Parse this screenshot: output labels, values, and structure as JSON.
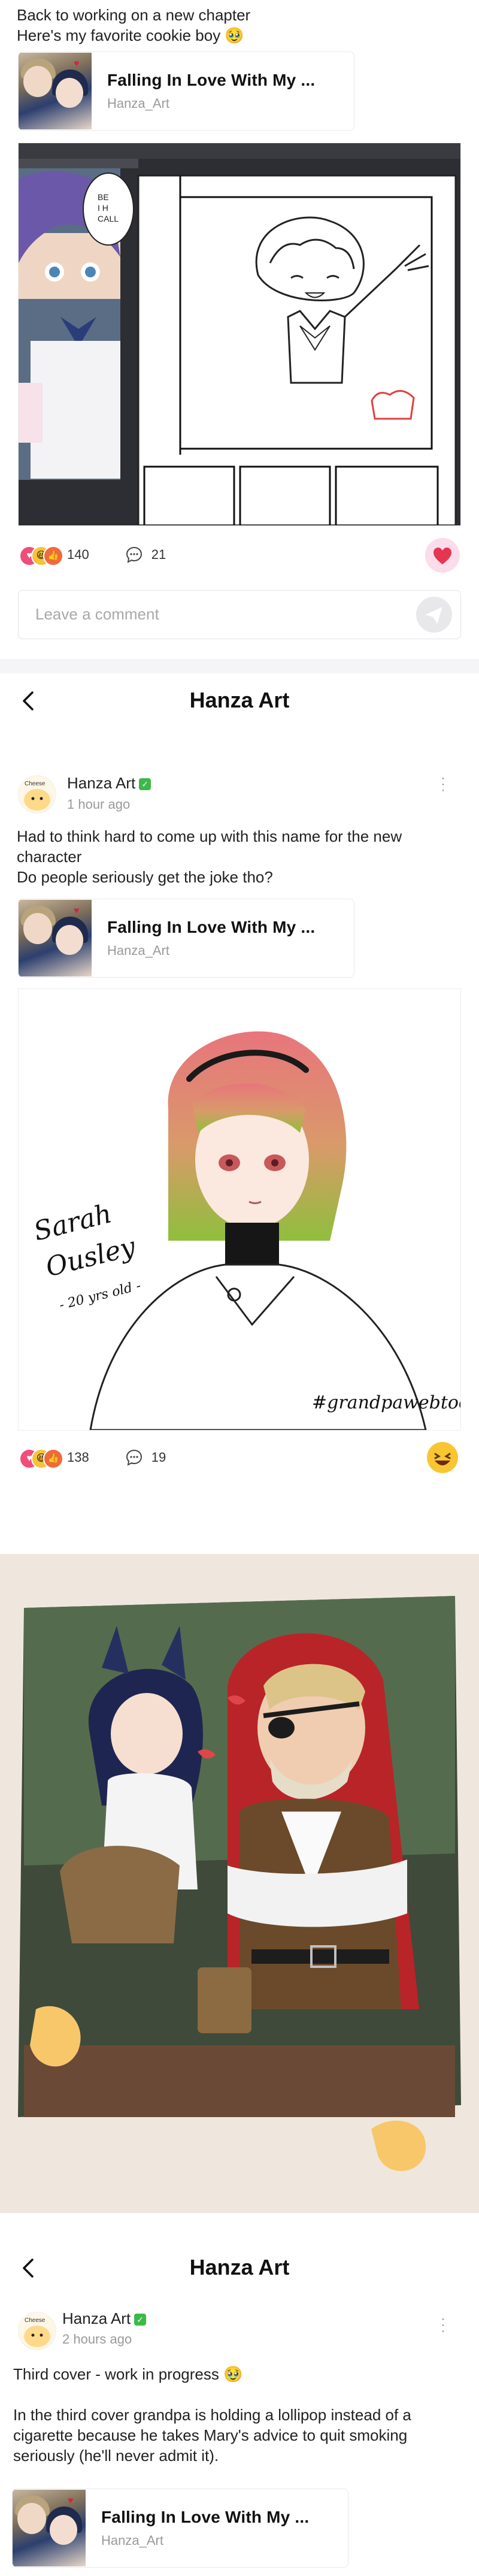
{
  "post1": {
    "text_line1": "Back to working on a new chapter",
    "text_line2": "Here's my favorite cookie boy 🥹",
    "series": {
      "title": "Falling In Love With My ...",
      "author": "Hanza_Art"
    },
    "reactions": {
      "count": "140",
      "comments": "21"
    },
    "comment_placeholder": "Leave a comment"
  },
  "post2": {
    "header_title": "Hanza Art",
    "author": "Hanza Art",
    "time": "1 hour ago",
    "text_line1": "Had to think hard to come up with this name for the new",
    "text_line2": "character",
    "text_line3": "Do people seriously get the joke tho?",
    "series": {
      "title": "Falling In Love With My ...",
      "author": "Hanza_Art"
    },
    "reactions": {
      "count": "138",
      "comments": "19"
    }
  },
  "post3": {
    "header_title": "Hanza Art",
    "author": "Hanza Art",
    "time": "2 hours ago",
    "text_line1": "Third cover - work in progress 🥹",
    "text_line2": "In the third cover grandpa is holding a lollipop instead of a",
    "text_line3": "cigarette because he takes Mary's advice to quit smoking",
    "text_line4": "seriously (he'll never admit it).",
    "series": {
      "title": "Falling In Love With My ...",
      "author": "Hanza_Art"
    }
  },
  "colors": {
    "accent_green": "#3cb94a",
    "heart_pink": "#f04d7a",
    "bg_gray": "#f5f5f7"
  },
  "icons": [
    "back-arrow-icon",
    "comment-icon",
    "send-icon",
    "heart-reaction-icon",
    "laugh-reaction-icon",
    "like-reaction-icon",
    "verified-icon",
    "more-icon"
  ]
}
